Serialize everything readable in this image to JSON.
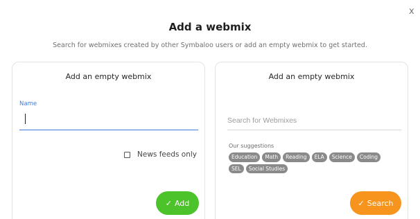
{
  "dialog": {
    "title": "Add a webmix",
    "subtitle": "Search for webmixes created by other Symbaloo users or add an empty webmix to get started.",
    "close_label": "x"
  },
  "left_panel": {
    "title": "Add an empty webmix",
    "name_label": "Name",
    "name_value": "",
    "news_feeds_label": "News feeds only",
    "news_feeds_checked": false,
    "add_button": {
      "icon": "checkmark-icon",
      "label": "Add",
      "color": "#4cc22b"
    }
  },
  "right_panel": {
    "title": "Add an empty webmix",
    "search_placeholder": "Search for Webmixes",
    "suggestions_title": "Our suggestions",
    "suggestions": [
      "Education",
      "Math",
      "Reading",
      "ELA",
      "Science",
      "Coding",
      "SEL",
      "Social Studies"
    ],
    "search_button": {
      "icon": "checkmark-icon",
      "label": "Search",
      "color": "#f7941d"
    }
  },
  "colors": {
    "accent_blue": "#3d7be0",
    "tag_gray": "#8a8a8a"
  }
}
